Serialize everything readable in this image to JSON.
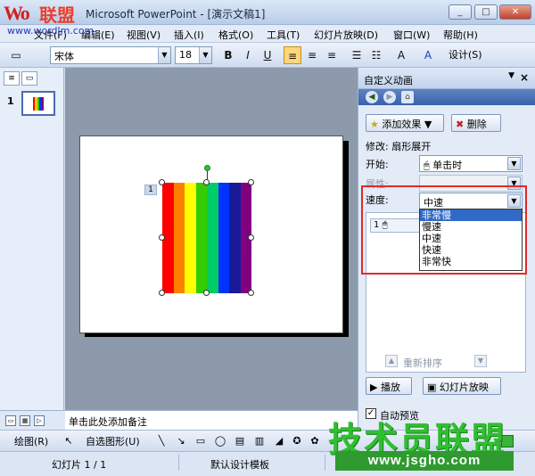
{
  "window": {
    "title": "Microsoft PowerPoint - [演示文稿1]",
    "logo_mark": "Wo",
    "logo_cn": "联盟",
    "watermark_url": "www.wordlm.com",
    "controls": [
      "_",
      "□",
      "✕"
    ]
  },
  "menu": {
    "items": [
      "文件(F)",
      "编辑(E)",
      "视图(V)",
      "插入(I)",
      "格式(O)",
      "工具(T)",
      "幻灯片放映(D)",
      "窗口(W)",
      "帮助(H)"
    ]
  },
  "toolbar": {
    "font": "宋体",
    "size": "18",
    "bold": "B",
    "italic": "I",
    "underline": "U",
    "design": "设计(S)"
  },
  "left_pane": {
    "slide_number": "1"
  },
  "slide": {
    "anim_tag": "1",
    "bar_colors": [
      "#ff0000",
      "#ff7f00",
      "#ffff00",
      "#33cc00",
      "#00cc66",
      "#0033ff",
      "#1a1a99",
      "#800080"
    ]
  },
  "notes": {
    "placeholder": "单击此处添加备注"
  },
  "task_pane": {
    "title": "自定义动画",
    "add_effect": "添加效果",
    "delete": "删除",
    "modify": "修改: 扇形展开",
    "start_label": "开始:",
    "start_value": "单击时",
    "property_label": "属性:",
    "speed_label": "速度:",
    "speed_value": "中速",
    "speed_options": [
      "非常慢",
      "慢速",
      "中速",
      "快速",
      "非常快"
    ],
    "anim_item": "1",
    "reorder": "重新排序",
    "play": "播放",
    "slideshow": "幻灯片放映",
    "autopreview": "自动预览"
  },
  "draw_toolbar": {
    "draw": "绘图(R)",
    "autoshapes": "自选图形(U)"
  },
  "status": {
    "slide": "幻灯片 1 / 1",
    "template": "默认设计模板"
  },
  "watermark": {
    "big_text": "技术员联盟",
    "url": "www.jsgho.com"
  },
  "colors": {
    "accent_red": "#e02a2a",
    "selection_blue": "#3169c6"
  }
}
